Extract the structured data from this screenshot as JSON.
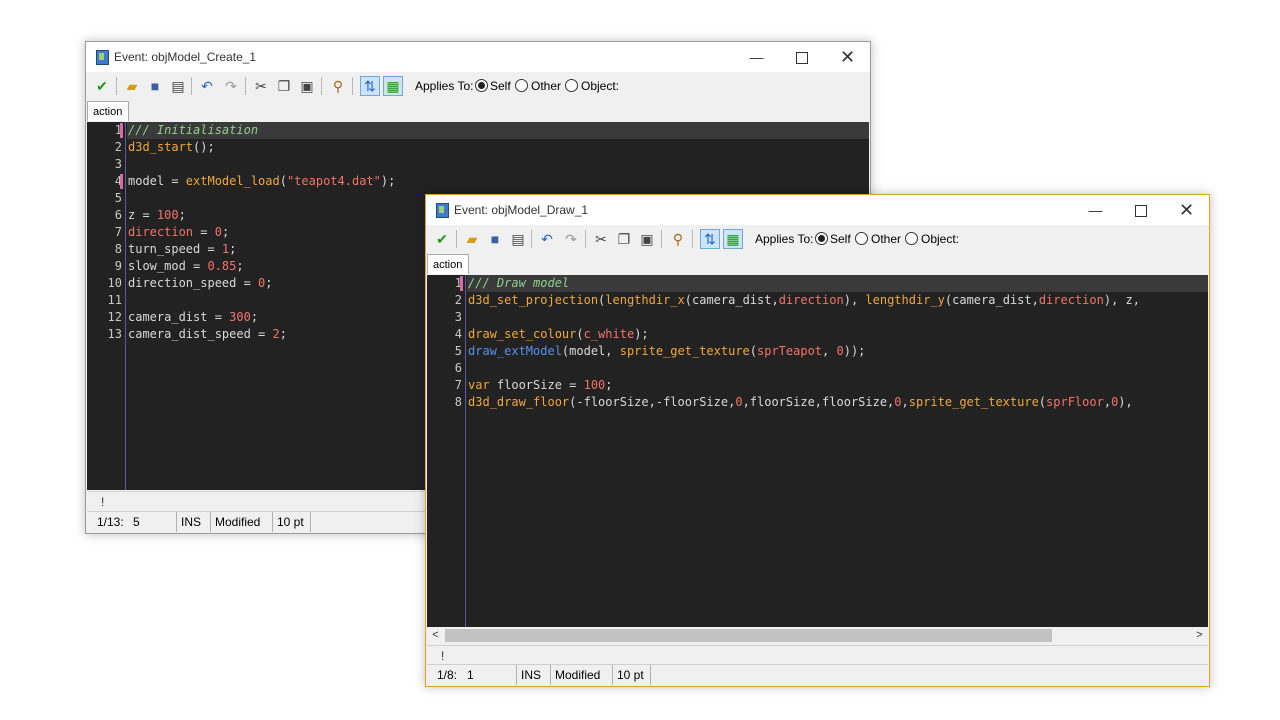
{
  "win1": {
    "title": "Event: objModel_Create_1",
    "tab": "action",
    "status": {
      "pos": "1/13:",
      "col": "5",
      "ins": "INS",
      "modified": "Modified",
      "size": "10 pt"
    },
    "bang": "!",
    "code": [
      [
        [
          "cm",
          "/// Initialisation"
        ]
      ],
      [
        [
          "fn",
          "d3d_start"
        ],
        [
          "p",
          "();"
        ]
      ],
      [],
      [
        [
          "p",
          "model = "
        ],
        [
          "fn",
          "extModel_load"
        ],
        [
          "p",
          "("
        ],
        [
          "st",
          "\"teapot4.dat\""
        ],
        [
          "p",
          ");"
        ]
      ],
      [],
      [
        [
          "p",
          "z = "
        ],
        [
          "nm",
          "100"
        ],
        [
          "p",
          ";"
        ]
      ],
      [
        [
          "bi",
          "direction"
        ],
        [
          "p",
          " = "
        ],
        [
          "nm",
          "0"
        ],
        [
          "p",
          ";"
        ]
      ],
      [
        [
          "p",
          "turn_speed = "
        ],
        [
          "nm",
          "1"
        ],
        [
          "p",
          ";"
        ]
      ],
      [
        [
          "p",
          "slow_mod = "
        ],
        [
          "nm",
          "0.85"
        ],
        [
          "p",
          ";"
        ]
      ],
      [
        [
          "p",
          "direction_speed = "
        ],
        [
          "nm",
          "0"
        ],
        [
          "p",
          ";"
        ]
      ],
      [],
      [
        [
          "p",
          "camera_dist = "
        ],
        [
          "nm",
          "300"
        ],
        [
          "p",
          ";"
        ]
      ],
      [
        [
          "p",
          "camera_dist_speed = "
        ],
        [
          "nm",
          "2"
        ],
        [
          "p",
          ";"
        ]
      ]
    ]
  },
  "win2": {
    "title": "Event: objModel_Draw_1",
    "tab": "action",
    "status": {
      "pos": "1/8:",
      "col": "1",
      "ins": "INS",
      "modified": "Modified",
      "size": "10 pt"
    },
    "bang": "!",
    "code": [
      [
        [
          "cm",
          "/// Draw model"
        ]
      ],
      [
        [
          "fn",
          "d3d_set_projection"
        ],
        [
          "p",
          "("
        ],
        [
          "fn",
          "lengthdir_x"
        ],
        [
          "p",
          "(camera_dist,"
        ],
        [
          "bi",
          "direction"
        ],
        [
          "p",
          "), "
        ],
        [
          "fn",
          "lengthdir_y"
        ],
        [
          "p",
          "(camera_dist,"
        ],
        [
          "bi",
          "direction"
        ],
        [
          "p",
          "), z,"
        ]
      ],
      [],
      [
        [
          "fn",
          "draw_set_colour"
        ],
        [
          "p",
          "("
        ],
        [
          "cst",
          "c_white"
        ],
        [
          "p",
          ");"
        ]
      ],
      [
        [
          "usr",
          "draw_extModel"
        ],
        [
          "p",
          "(model, "
        ],
        [
          "fn",
          "sprite_get_texture"
        ],
        [
          "p",
          "("
        ],
        [
          "res",
          "sprTeapot"
        ],
        [
          "p",
          ", "
        ],
        [
          "nm",
          "0"
        ],
        [
          "p",
          "));"
        ]
      ],
      [],
      [
        [
          "kw",
          "var"
        ],
        [
          "p",
          " floorSize = "
        ],
        [
          "nm",
          "100"
        ],
        [
          "p",
          ";"
        ]
      ],
      [
        [
          "fn",
          "d3d_draw_floor"
        ],
        [
          "p",
          "(-floorSize,-floorSize,"
        ],
        [
          "nm",
          "0"
        ],
        [
          "p",
          ",floorSize,floorSize,"
        ],
        [
          "nm",
          "0"
        ],
        [
          "p",
          ","
        ],
        [
          "fn",
          "sprite_get_texture"
        ],
        [
          "p",
          "("
        ],
        [
          "res",
          "sprFloor"
        ],
        [
          "p",
          ","
        ],
        [
          "nm",
          "0"
        ],
        [
          "p",
          "),"
        ]
      ]
    ]
  },
  "toolbar": {
    "applies_to": "Applies To:",
    "self": "Self",
    "other": "Other",
    "object": "Object:",
    "icons": [
      "ok-check-icon",
      "open-folder-icon",
      "save-icon",
      "print-icon",
      "undo-icon",
      "redo-icon",
      "cut-icon",
      "copy-icon",
      "paste-icon",
      "find-icon",
      "toggle-a-icon",
      "toggle-b-icon"
    ]
  },
  "window_controls": {
    "minimize": "—",
    "maximize": "",
    "close": "✕"
  },
  "colors": {
    "editor_bg": "#222222",
    "comment": "#8fd08f",
    "function": "#f0a83a",
    "number": "#f27368",
    "active_border": "#e0a12c"
  }
}
